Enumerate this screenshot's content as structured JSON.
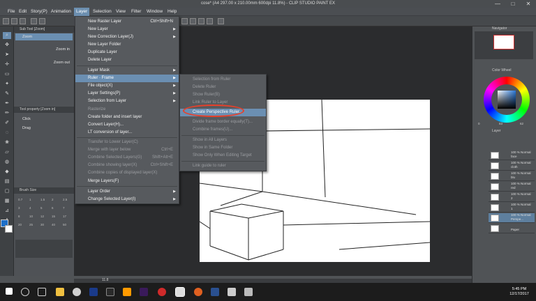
{
  "window": {
    "title": "cose* (A4 297.00 x 210.00mm 600dpi 11.8%) - CLIP STUDIO PAINT EX",
    "minimize": "—",
    "maximize": "□",
    "close": "✕"
  },
  "menubar": [
    "File",
    "Edit",
    "Story(P)",
    "Animation",
    "Layer",
    "Selection",
    "View",
    "Filter",
    "Window",
    "Help"
  ],
  "left_panel": {
    "subtool_header": "Sub Tool [Zoom]",
    "subtool_item": "Zoom",
    "zoom_in": "Zoom in",
    "zoom_out": "Zoom out",
    "tool_property_header": "Tool property [Zoom in]",
    "click_label": "Click",
    "drag_label": "Drag",
    "brush_size_header": "Brush Size",
    "brush_sizes": [
      "0.7",
      "1",
      "1.5",
      "2",
      "2.5",
      "3",
      "4",
      "5",
      "6",
      "7",
      "8",
      "10",
      "12",
      "15",
      "17",
      "20",
      "25",
      "30",
      "40",
      "50"
    ]
  },
  "layer_menu": {
    "items": [
      {
        "label": "New Raster Layer",
        "shortcut": "Ctrl+Shift+N"
      },
      {
        "label": "New Layer",
        "arrow": true
      },
      {
        "label": "New Correction Layer(J)",
        "arrow": true
      },
      {
        "label": "New Layer Folder"
      },
      {
        "label": "Duplicate Layer"
      },
      {
        "label": "Delete Layer"
      },
      {
        "label": "Layer Mask",
        "arrow": true
      },
      {
        "label": "Ruler · Frame",
        "arrow": true,
        "highlighted": true
      },
      {
        "label": "File object(X)",
        "arrow": true
      },
      {
        "label": "Layer Settings(P)",
        "arrow": true
      },
      {
        "label": "Selection from Layer",
        "arrow": true
      },
      {
        "label": "Rasterize",
        "disabled": true
      },
      {
        "label": "Create folder and insert layer"
      },
      {
        "label": "Convert Layer(H)..."
      },
      {
        "label": "LT conversion of layer..."
      },
      {
        "label": "Transfer to Lower Layer(C)",
        "disabled": true
      },
      {
        "label": "Merge with layer below",
        "shortcut": "Ctrl+E",
        "disabled": true
      },
      {
        "label": "Combine Selected Layers(G)",
        "shortcut": "Shift+Alt+E",
        "disabled": true
      },
      {
        "label": "Combine showing layer(X)",
        "shortcut": "Ctrl+Shift+E",
        "disabled": true
      },
      {
        "label": "Combine copies of displayed layer(X)",
        "disabled": true
      },
      {
        "label": "Merge Layers(F)"
      },
      {
        "label": "Layer Order",
        "arrow": true
      },
      {
        "label": "Change Selected Layer(I)",
        "arrow": true
      }
    ]
  },
  "ruler_submenu": {
    "items": [
      {
        "label": "Selection from Ruler",
        "disabled": true
      },
      {
        "label": "Delete Ruler",
        "disabled": true
      },
      {
        "label": "Show Ruler(B)",
        "disabled": true
      },
      {
        "label": "Link Ruler to Layer",
        "disabled": true
      },
      {
        "label": "Create Perspective Ruler...",
        "highlighted": true
      },
      {
        "label": "Divide frame border equally(T)...",
        "disabled": true
      },
      {
        "label": "Combine frames(U)...",
        "disabled": true
      },
      {
        "label": "Show in All Layers",
        "disabled": true
      },
      {
        "label": "Show in Same Folder",
        "disabled": true
      },
      {
        "label": "Show Only When Editing Target",
        "disabled": true
      },
      {
        "label": "Link guide to ruler",
        "disabled": true
      }
    ]
  },
  "right_panel": {
    "navigator_label": "Navigator",
    "color_wheel_label": "Color Wheel",
    "layer_label": "Layer",
    "color_values": {
      "h": "0",
      "s": "83",
      "v": "62"
    },
    "layers": [
      {
        "pct": "100 %",
        "mode": "Normal",
        "name": "face"
      },
      {
        "pct": "100 %",
        "mode": "Normal",
        "name": "cloth"
      },
      {
        "pct": "100 %",
        "mode": "Normal",
        "name": "blu"
      },
      {
        "pct": "100 %",
        "mode": "Normal",
        "name": "red"
      },
      {
        "pct": "100 %",
        "mode": "Normal",
        "name": "2"
      },
      {
        "pct": "100 %",
        "mode": "Normal",
        "name": "1"
      },
      {
        "pct": "100 %",
        "mode": "Normal",
        "name": "Perspe..."
      },
      {
        "pct": "",
        "mode": "",
        "name": "Paper"
      }
    ]
  },
  "statusbar": {
    "zoom": "11.8"
  },
  "taskbar": {
    "time": "5:45 PM",
    "date": "12/17/2017"
  }
}
